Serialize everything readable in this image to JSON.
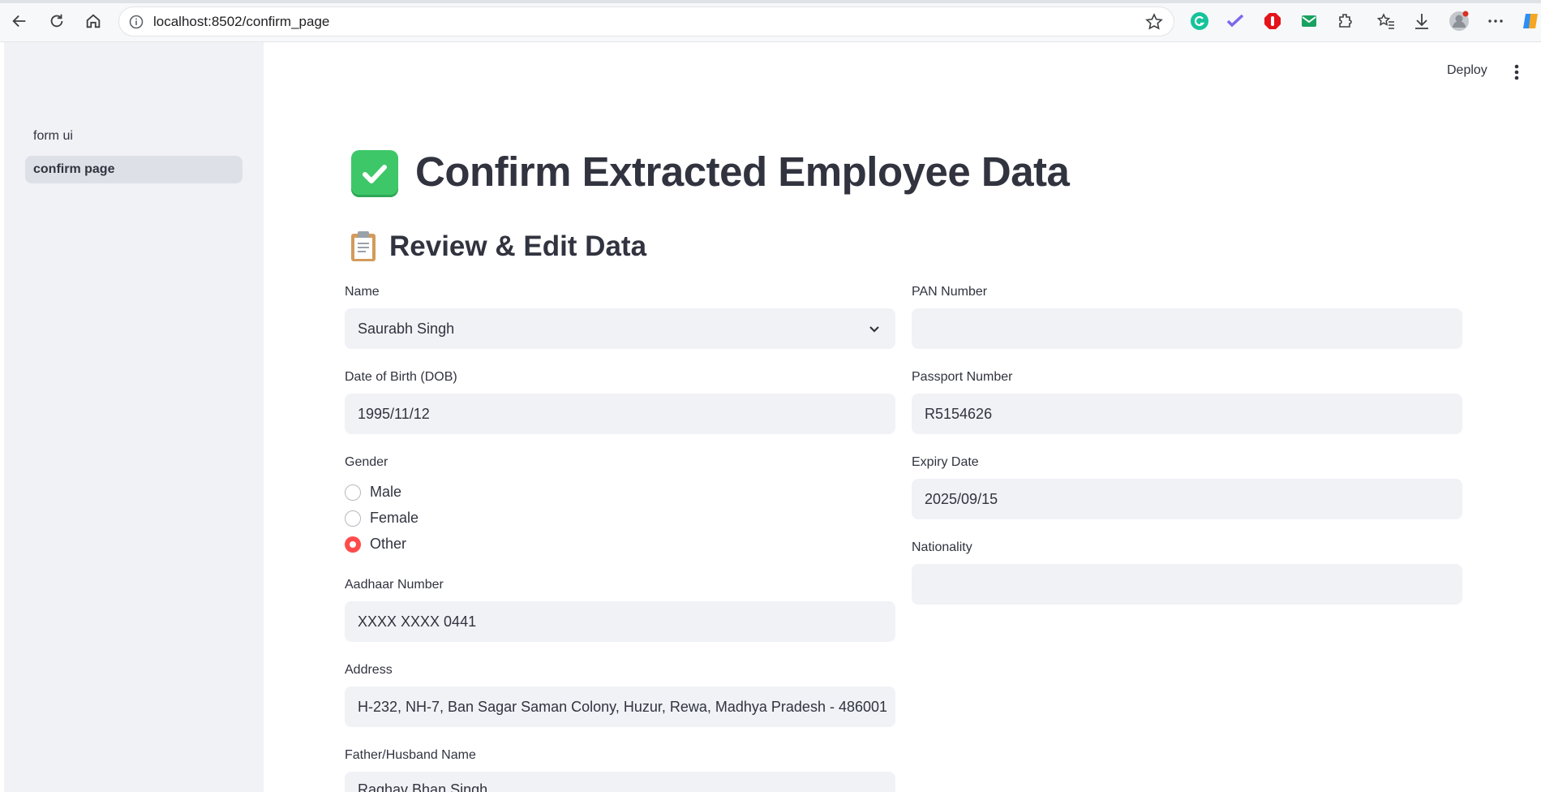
{
  "browser": {
    "url": "localhost:8502/confirm_page"
  },
  "sidebar": {
    "items": [
      {
        "label": "form ui"
      },
      {
        "label": "confirm page"
      }
    ]
  },
  "header": {
    "deploy_label": "Deploy"
  },
  "main": {
    "title": "Confirm Extracted Employee Data",
    "subtitle": "Review & Edit Data",
    "left": {
      "name": {
        "label": "Name",
        "value": "Saurabh Singh"
      },
      "dob": {
        "label": "Date of Birth (DOB)",
        "value": "1995/11/12"
      },
      "gender": {
        "label": "Gender",
        "options": [
          "Male",
          "Female",
          "Other"
        ],
        "selected": "Other"
      },
      "aadhaar": {
        "label": "Aadhaar Number",
        "value": "XXXX XXXX 0441"
      },
      "address": {
        "label": "Address",
        "value": "H-232, NH-7, Ban Sagar Saman Colony, Huzur, Rewa, Madhya Pradesh - 486001"
      },
      "father": {
        "label": "Father/Husband Name",
        "value": "Raghav Bhan Singh"
      }
    },
    "right": {
      "pan": {
        "label": "PAN Number",
        "value": ""
      },
      "passport": {
        "label": "Passport Number",
        "value": "R5154626"
      },
      "expiry": {
        "label": "Expiry Date",
        "value": "2025/09/15"
      },
      "nationality": {
        "label": "Nationality",
        "value": ""
      }
    }
  },
  "colors": {
    "accent": "#ff4b4b",
    "sidebar_bg": "#f0f2f6",
    "field_bg": "#f0f2f6"
  }
}
